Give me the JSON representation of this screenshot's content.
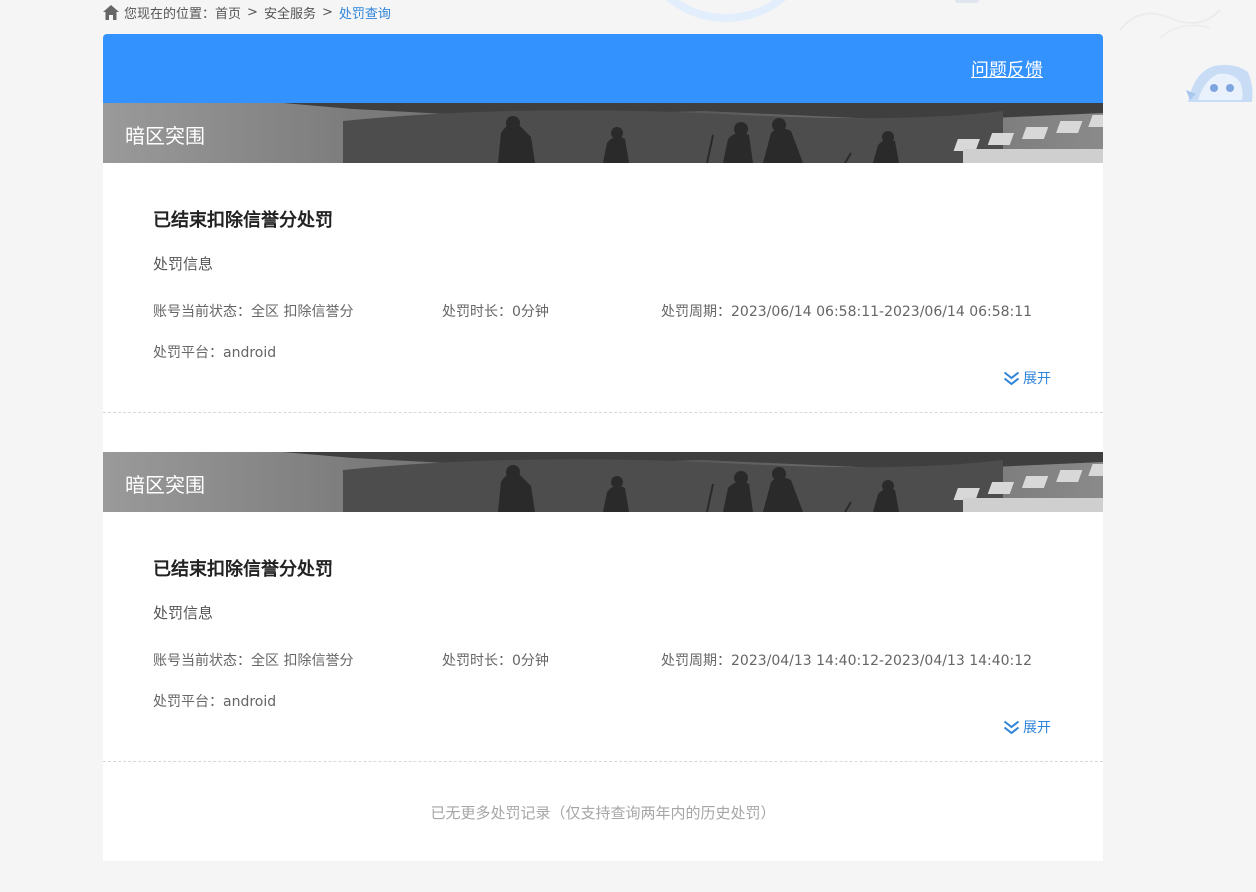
{
  "breadcrumb": {
    "prefix": "您现在的位置：",
    "items": [
      "首页",
      "安全服务",
      "处罚查询"
    ],
    "separator": ">"
  },
  "header": {
    "feedback_label": "问题反馈",
    "bar_color": "#3392fe"
  },
  "labels": {
    "status_prefix": "账号当前状态：",
    "duration_prefix": "处罚时长：",
    "period_prefix": "处罚周期：",
    "platform_prefix": "处罚平台：",
    "expand": "展开",
    "section": "处罚信息"
  },
  "records": [
    {
      "game": "暗区突围",
      "title": "已结束扣除信誉分处罚",
      "status": "账号当前状态：全区 扣除信誉分",
      "duration": "处罚时长：0分钟",
      "period": "处罚周期：2023/06/14 06:58:11-2023/06/14 06:58:11",
      "platform": "处罚平台：android"
    },
    {
      "game": "暗区突围",
      "title": "已结束扣除信誉分处罚",
      "status": "账号当前状态：全区 扣除信誉分",
      "duration": "处罚时长：0分钟",
      "period": "处罚周期：2023/04/13 14:40:12-2023/04/13 14:40:12",
      "platform": "处罚平台：android"
    }
  ],
  "footer": {
    "note": "已无更多处罚记录（仅支持查询两年内的历史处罚）"
  },
  "icons": [
    "home-icon",
    "expand-chevron-icon"
  ],
  "colors": {
    "accent": "#3392fe",
    "link": "#2f84db",
    "background": "#f5f5f6"
  }
}
